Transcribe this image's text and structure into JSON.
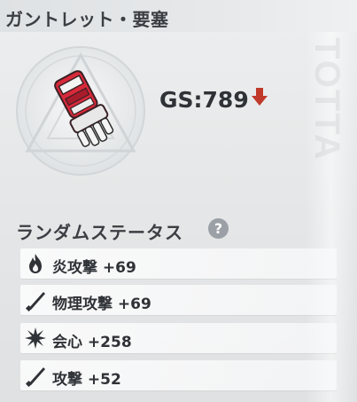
{
  "header": {
    "title": "ガントレット・要塞"
  },
  "item": {
    "gs_text": "GS:789",
    "trend_icon": "down-arrow-icon",
    "trend_color": "#c0392b"
  },
  "random_status": {
    "title": "ランダムステータス",
    "help_icon": "question-circle-icon",
    "stats": [
      {
        "icon": "flame-icon",
        "label": "炎攻撃 +69"
      },
      {
        "icon": "blade-icon",
        "label": "物理攻撃 +69"
      },
      {
        "icon": "burst-icon",
        "label": "会心 +258"
      },
      {
        "icon": "blade-icon",
        "label": "攻撃 +52"
      }
    ]
  }
}
